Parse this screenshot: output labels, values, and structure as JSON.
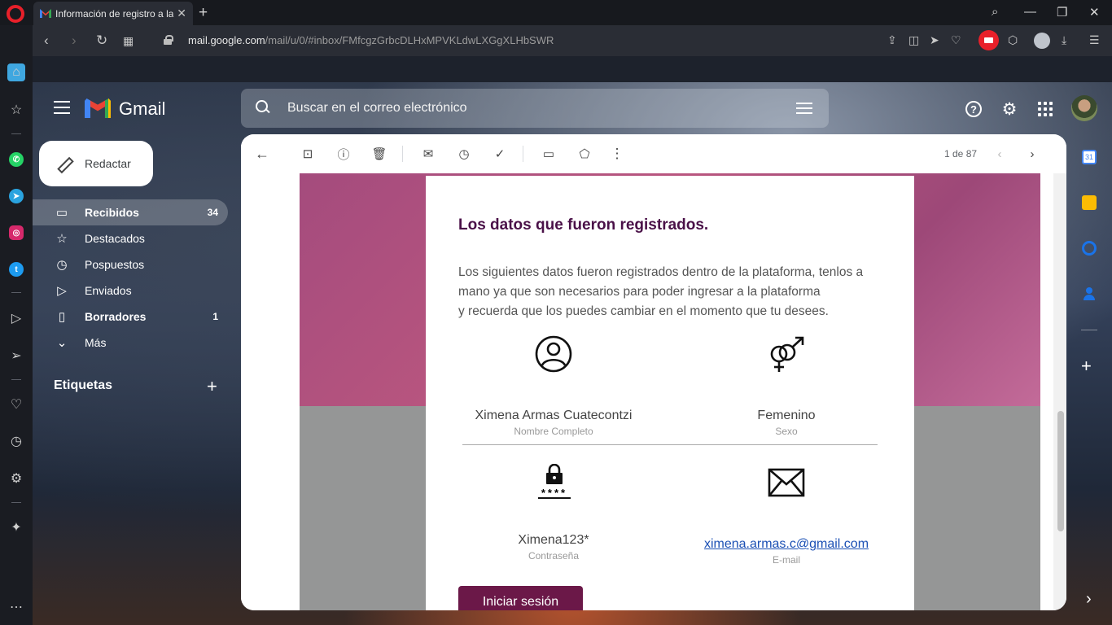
{
  "browser": {
    "tab_title": "Información de registro a la",
    "tab_close": "✕",
    "new_tab": "+",
    "url_host": "mail.google.com",
    "url_path": "/mail/u/0/#inbox/FMfcgzGrbcDLHxMPVKLdwLXGgXLHbSWR"
  },
  "gmail": {
    "brand": "Gmail",
    "search_placeholder": "Buscar en el correo electrónico",
    "compose_label": "Redactar",
    "nav": [
      {
        "label": "Recibidos",
        "count": "34",
        "icon": "inbox-icon"
      },
      {
        "label": "Destacados",
        "count": "",
        "icon": "star-icon"
      },
      {
        "label": "Pospuestos",
        "count": "",
        "icon": "clock-icon"
      },
      {
        "label": "Enviados",
        "count": "",
        "icon": "send-icon"
      },
      {
        "label": "Borradores",
        "count": "1",
        "icon": "draft-icon"
      },
      {
        "label": "Más",
        "count": "",
        "icon": "chevron-down-icon"
      }
    ],
    "labels_header": "Etiquetas",
    "labels_add": "+",
    "pager": "1 de 87"
  },
  "email": {
    "heading": "Los datos que fueron registrados.",
    "paragraph_line1": "Los siguientes datos fueron registrados dentro de la plataforma, tenlos a",
    "paragraph_line2": "mano ya que son necesarios para poder ingresar a la plataforma",
    "paragraph_line3": "y recuerda que los puedes cambiar en el momento que tu desees.",
    "name_value": "Ximena Armas Cuatecontzi",
    "name_label": "Nombre Completo",
    "sex_value": "Femenino",
    "sex_label": "Sexo",
    "password_value": "Ximena123*",
    "password_label": "Contraseña",
    "email_value": "ximena.armas.c@gmail.com",
    "email_label": "E-mail",
    "login_button": "Iniciar sesión",
    "password_stars": "****"
  },
  "colors": {
    "heading": "#4a1148",
    "button": "#6b1848",
    "banner": "#a44b7d"
  }
}
